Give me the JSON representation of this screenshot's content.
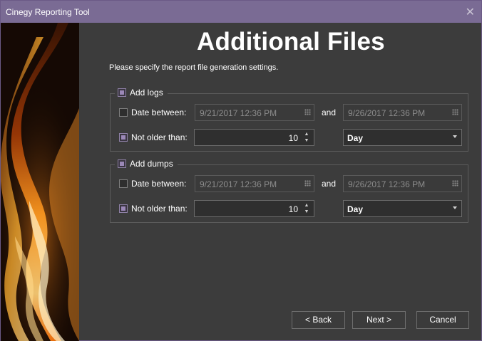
{
  "window": {
    "title": "Cinegy Reporting Tool"
  },
  "header": {
    "title": "Additional Files",
    "subtitle": "Please specify the report file generation settings."
  },
  "logs": {
    "label": "Add logs",
    "checked": true,
    "date_between": {
      "label": "Date between:",
      "checked": false,
      "from": "9/21/2017 12:36 PM",
      "and_label": "and",
      "to": "9/26/2017 12:36 PM"
    },
    "not_older": {
      "label": "Not older than:",
      "checked": true,
      "value": "10",
      "unit": "Day"
    }
  },
  "dumps": {
    "label": "Add dumps",
    "checked": true,
    "date_between": {
      "label": "Date between:",
      "checked": false,
      "from": "9/21/2017 12:36 PM",
      "and_label": "and",
      "to": "9/26/2017 12:36 PM"
    },
    "not_older": {
      "label": "Not older than:",
      "checked": true,
      "value": "10",
      "unit": "Day"
    }
  },
  "buttons": {
    "back": "< Back",
    "next": "Next >",
    "cancel": "Cancel"
  },
  "icons": {
    "close": "close-icon",
    "calendar": "calendar-grid-icon",
    "spinner": "spinner-arrows-icon",
    "dropdown": "chevron-down-icon"
  },
  "colors": {
    "titlebar": "#7a6b94",
    "background": "#3c3c3c",
    "check_accent": "#9b88b7"
  }
}
